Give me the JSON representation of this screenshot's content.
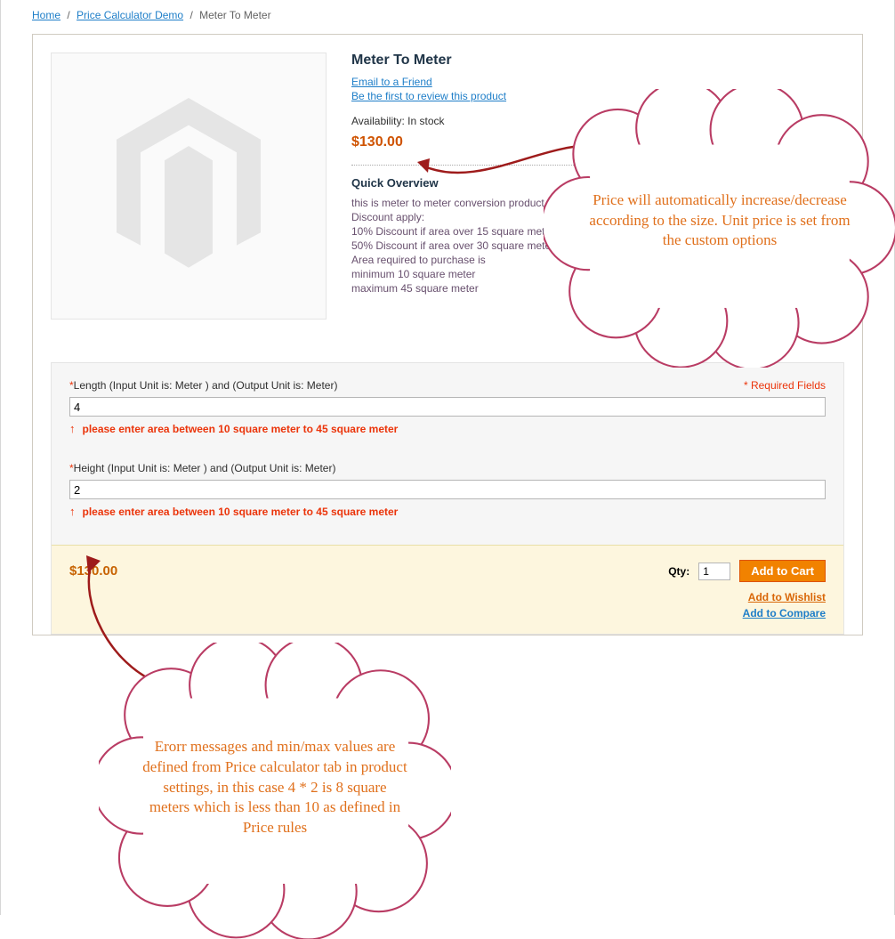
{
  "breadcrumb": {
    "home": "Home",
    "cat": "Price Calculator Demo",
    "current": "Meter To Meter"
  },
  "product": {
    "title": "Meter To Meter",
    "email_link": "Email to a Friend",
    "review_link": "Be the first to review this product",
    "availability_label": "Availability:",
    "availability_value": "In stock",
    "price": "$130.00"
  },
  "overview": {
    "heading": "Quick Overview",
    "lines": [
      "this is meter to meter conversion product.",
      "Discount apply:",
      "10% Discount if area over 15 square meter",
      "50% Discount if area over 30 square meter",
      "Area required to purchase is",
      "minimum 10 square meter",
      "maximum 45 square meter"
    ]
  },
  "form": {
    "required_note": "* Required Fields",
    "length_label": "Length (Input Unit is: Meter ) and (Output Unit is: Meter)",
    "length_value": "4",
    "height_label": "Height (Input Unit is: Meter ) and (Output Unit is: Meter)",
    "height_value": "2",
    "error_msg": "please enter area between 10 square meter to 45 square meter"
  },
  "buy": {
    "price": "$130.00",
    "qty_label": "Qty:",
    "qty_value": "1",
    "cart_btn": "Add to Cart",
    "wishlist": "Add to Wishlist",
    "compare": "Add to Compare"
  },
  "callouts": {
    "c1": "Price will automatically increase/decrease according to the size. Unit price is set from the custom options",
    "c2": "Erorr messages and min/max values are defined from Price calculator tab in product settings, in this case 4 * 2 is 8 square meters which is less than 10 as defined in Price rules"
  }
}
